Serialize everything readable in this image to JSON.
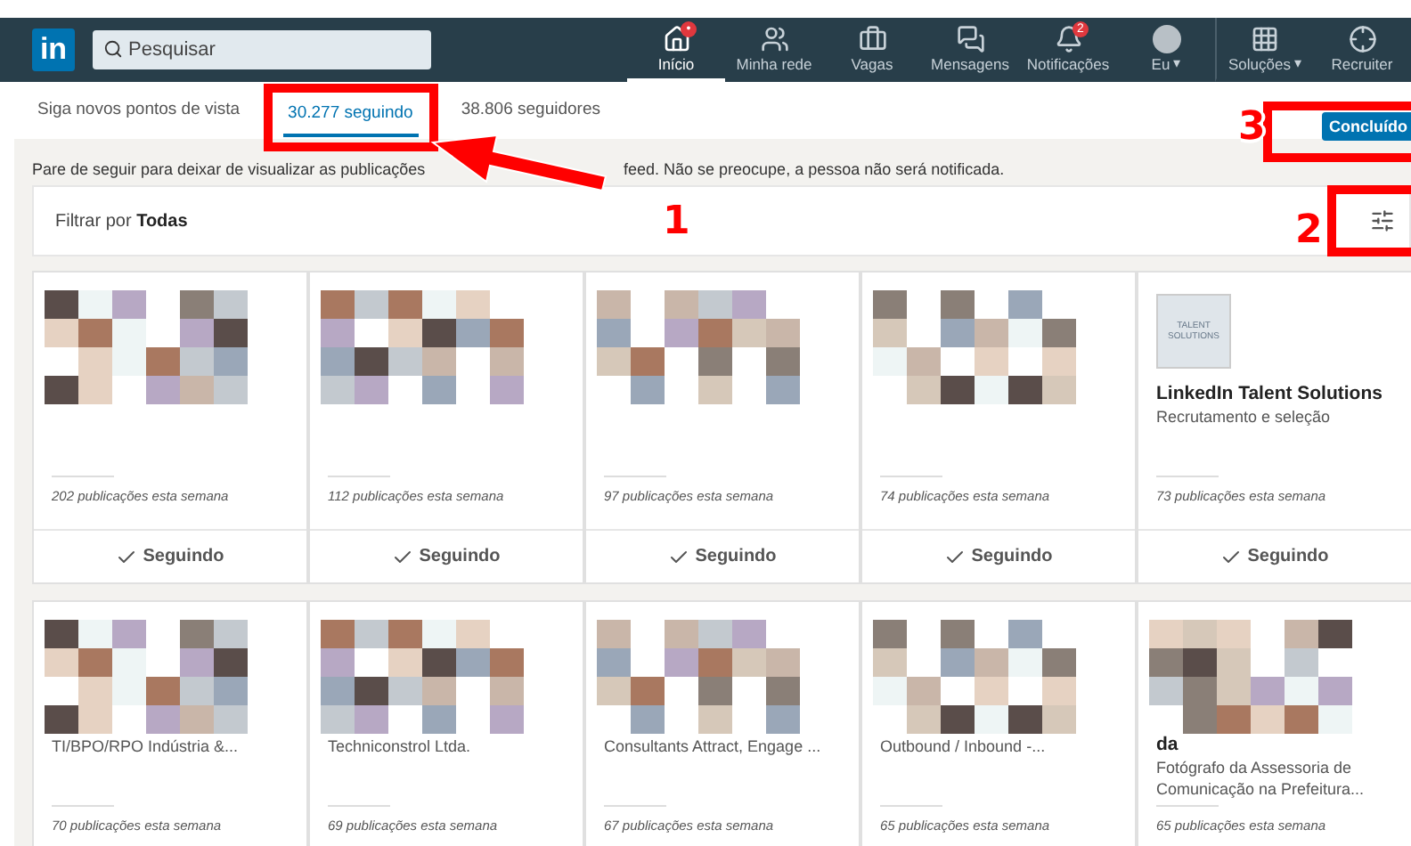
{
  "nav": {
    "logo": "in",
    "search": {
      "placeholder": "Pesquisar"
    },
    "items": [
      {
        "kind": "home",
        "label": "Início",
        "selected": true,
        "badge": "•"
      },
      {
        "kind": "network",
        "label": "Minha rede",
        "selected": false
      },
      {
        "kind": "jobs",
        "label": "Vagas",
        "selected": false
      },
      {
        "kind": "messages",
        "label": "Mensagens",
        "selected": false
      },
      {
        "kind": "notifications",
        "label": "Notificações",
        "selected": false,
        "badge": "2"
      },
      {
        "kind": "me",
        "label": "Eu",
        "selected": false,
        "caret": "▾"
      },
      {
        "kind": "apps",
        "label": "Soluções",
        "selected": false,
        "caret": "▾"
      },
      {
        "kind": "recruiter",
        "label": "Recruiter",
        "selected": false
      }
    ]
  },
  "tabs": [
    {
      "label": "Siga novos pontos de vista",
      "selected": false
    },
    {
      "label": "30.277 seguindo",
      "selected": true
    },
    {
      "label": "38.806 seguidores",
      "selected": false
    }
  ],
  "done_button": "Concluído",
  "info_start": "Pare de seguir para deixar de visualizar as publicações",
  "info_end": "feed. Não se preocupe, a pessoa não será notificada.",
  "filter": {
    "label": "Filtrar por",
    "value": "Todas"
  },
  "cards": [
    {
      "kind": "person",
      "posts": "202 publicações esta semana",
      "button": "Seguindo"
    },
    {
      "kind": "person",
      "posts": "112 publicações esta semana",
      "button": "Seguindo"
    },
    {
      "kind": "person",
      "posts": "97 publicações esta semana",
      "button": "Seguindo"
    },
    {
      "kind": "person",
      "posts": "74 publicações esta semana",
      "button": "Seguindo"
    },
    {
      "kind": "company",
      "logo_text": "TALENT SOLUTIONS",
      "title": "LinkedIn Talent Solutions",
      "subtitle": "Recrutamento e seleção",
      "posts": "73 publicações esta semana",
      "button": "Seguindo"
    },
    {
      "kind": "person",
      "subtitle": "TI/BPO/RPO Indústria &...",
      "posts": "70 publicações esta semana"
    },
    {
      "kind": "person",
      "subtitle": "Techniconstrol Ltda.",
      "posts": "69 publicações esta semana"
    },
    {
      "kind": "person",
      "subtitle": "Consultants Attract, Engage ...",
      "posts": "67 publicações esta semana"
    },
    {
      "kind": "person",
      "subtitle": "Outbound / Inbound -...",
      "posts": "65 publicações esta semana"
    },
    {
      "kind": "person",
      "title": "da",
      "subtitle": "Fotógrafo da Assessoria de Comunicação na Prefeitura...",
      "posts": "65 publicações esta semana"
    }
  ],
  "annotations": [
    "1",
    "2",
    "3"
  ]
}
